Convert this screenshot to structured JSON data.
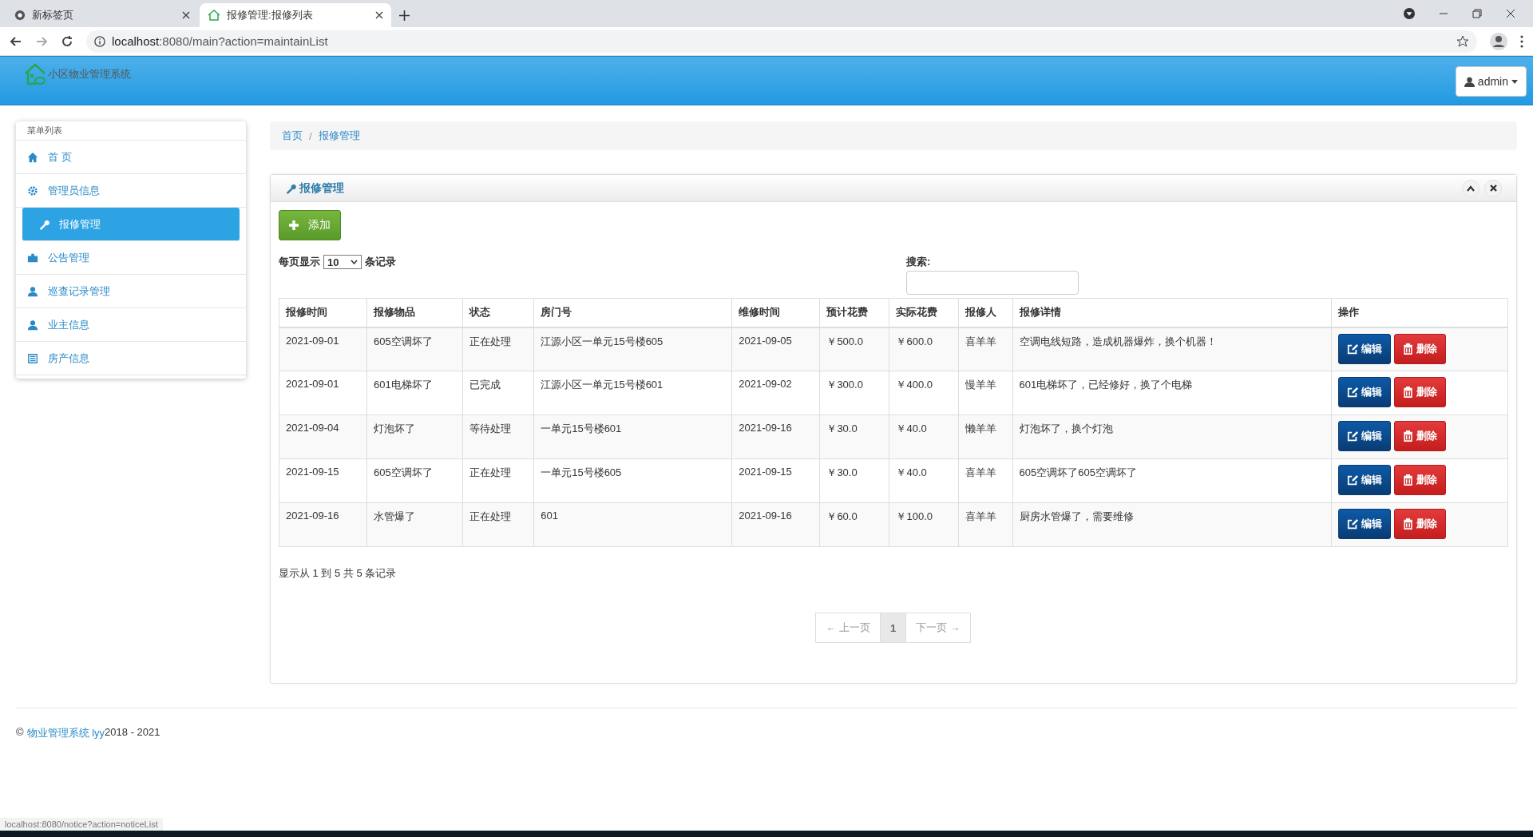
{
  "browser": {
    "tabs": [
      {
        "title": "新标签页",
        "selected": false
      },
      {
        "title": "报修管理:报修列表",
        "selected": true
      }
    ],
    "url_host": "localhost",
    "url_rest": ":8080/main?action=maintainList"
  },
  "header": {
    "title": "小区物业管理系统",
    "user": "admin"
  },
  "sidebar": {
    "title": "菜单列表",
    "items": [
      {
        "label": "首 页",
        "selected": false
      },
      {
        "label": "管理员信息",
        "selected": false
      },
      {
        "label": "报修管理",
        "selected": true
      },
      {
        "label": "公告管理",
        "selected": false
      },
      {
        "label": "巡查记录管理",
        "selected": false
      },
      {
        "label": "业主信息",
        "selected": false
      },
      {
        "label": "房产信息",
        "selected": false
      }
    ]
  },
  "breadcrumb": [
    "首页",
    "报修管理"
  ],
  "breadcrumb_separator": "/",
  "panel": {
    "title": "报修管理",
    "add_button": "添加",
    "length_prefix": "每页显示",
    "length_value": "10",
    "length_suffix": "条记录",
    "search_label": "搜索:",
    "table": {
      "columns": [
        "报修时间",
        "报修物品",
        "状态",
        "房门号",
        "维修时间",
        "预计花费",
        "实际花费",
        "报修人",
        "报修详情",
        "操作"
      ],
      "rows": [
        {
          "cells": [
            "2021-09-01",
            "605空调坏了",
            "正在处理",
            "江源小区一单元15号楼605",
            "2021-09-05",
            "￥500.0",
            "￥600.0",
            "喜羊羊",
            "空调电线短路，造成机器爆炸，换个机器！"
          ],
          "actions": [
            "编辑",
            "删除"
          ]
        },
        {
          "cells": [
            "2021-09-01",
            "601电梯坏了",
            "已完成",
            "江源小区一单元15号楼601",
            "2021-09-02",
            "￥300.0",
            "￥400.0",
            "慢羊羊",
            "601电梯坏了，已经修好，换了个电梯"
          ],
          "actions": [
            "编辑",
            "删除"
          ]
        },
        {
          "cells": [
            "2021-09-04",
            "灯泡坏了",
            "等待处理",
            "一单元15号楼601",
            "2021-09-16",
            "￥30.0",
            "￥40.0",
            "懒羊羊",
            "灯泡坏了，换个灯泡"
          ],
          "actions": [
            "编辑",
            "删除"
          ]
        },
        {
          "cells": [
            "2021-09-15",
            "605空调坏了",
            "正在处理",
            "一单元15号楼605",
            "2021-09-15",
            "￥30.0",
            "￥40.0",
            "喜羊羊",
            "605空调坏了605空调坏了"
          ],
          "actions": [
            "编辑",
            "删除"
          ]
        },
        {
          "cells": [
            "2021-09-16",
            "水管爆了",
            "正在处理",
            "601",
            "2021-09-16",
            "￥60.0",
            "￥100.0",
            "喜羊羊",
            "厨房水管爆了，需要维修"
          ],
          "actions": [
            "编辑",
            "删除"
          ]
        }
      ]
    },
    "info": "显示从 1 到 5 共 5 条记录",
    "pagination": [
      {
        "label": "← 上一页",
        "selected": false,
        "disabled": true
      },
      {
        "label": "1",
        "selected": true,
        "disabled": false
      },
      {
        "label": "下一页 →",
        "selected": false,
        "disabled": true
      }
    ]
  },
  "footer": {
    "copyright": "©",
    "link": "物业管理系统 lyy",
    "years": "2018 - 2021"
  },
  "status_url": "localhost:8080/notice?action=noticeList"
}
